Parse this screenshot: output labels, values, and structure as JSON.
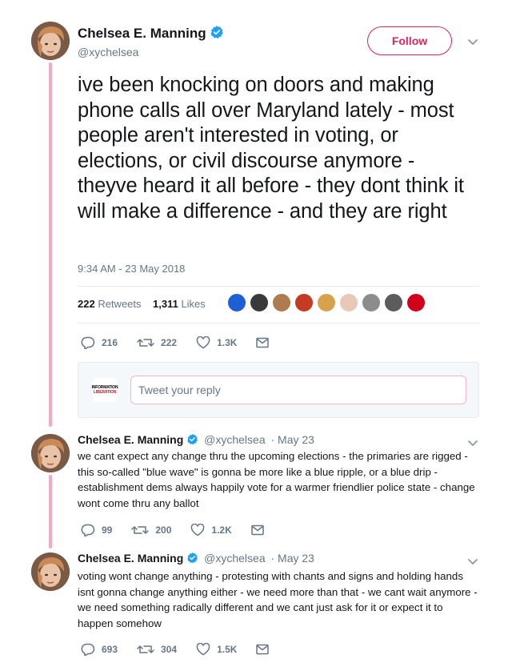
{
  "main_tweet": {
    "author_name": "Chelsea E. Manning",
    "author_handle": "@xychelsea",
    "follow_label": "Follow",
    "text": "ive been knocking on doors and making phone calls all over Maryland lately - most people aren't interested in voting, or elections, or civil discourse anymore - theyve heard it all before - they dont think it will make a difference - and they are right",
    "timestamp": "9:34 AM - 23 May 2018",
    "retweets_count": "222",
    "retweets_label": "Retweets",
    "likes_count": "1,311",
    "likes_label": "Likes",
    "actions": {
      "replies": "216",
      "retweets": "222",
      "likes": "1.3K"
    }
  },
  "likers": [
    {
      "name": "liker-1",
      "color": "#1f5fd6"
    },
    {
      "name": "liker-2",
      "color": "#3a3a3a"
    },
    {
      "name": "liker-3",
      "color": "#b07a4f"
    },
    {
      "name": "liker-4",
      "color": "#c23b22"
    },
    {
      "name": "liker-5",
      "color": "#d8a24c"
    },
    {
      "name": "liker-6",
      "color": "#e7c9b5"
    },
    {
      "name": "liker-7",
      "color": "#8c8c8c"
    },
    {
      "name": "liker-8",
      "color": "#5c5c5c"
    },
    {
      "name": "liker-9",
      "color": "#d0021b"
    }
  ],
  "reply_box": {
    "placeholder": "Tweet your reply",
    "avatar_line1": "INFORMATION",
    "avatar_line2": "LIBERATION"
  },
  "replies": [
    {
      "author_name": "Chelsea E. Manning",
      "author_handle": "@xychelsea",
      "date": "· May 23",
      "text": "we cant expect any change thru the upcoming elections - the primaries are rigged - this so-called \"blue wave\" is gonna be more like a blue ripple, or a blue drip - establishment dems always happily vote for a warmer friendlier police state - change wont come thru any ballot",
      "actions": {
        "replies": "99",
        "retweets": "200",
        "likes": "1.2K"
      }
    },
    {
      "author_name": "Chelsea E. Manning",
      "author_handle": "@xychelsea",
      "date": "· May 23",
      "text": "voting wont change anything - protesting with chants and signs and holding hands isnt gonna change anything either - we need more than that - we cant wait anymore - we need something radically different and we cant just ask for it or expect it to happen somehow",
      "actions": {
        "replies": "693",
        "retweets": "304",
        "likes": "1.5K"
      }
    }
  ],
  "colors": {
    "thread_line": "#f6a9c4",
    "follow_accent": "#e0245e",
    "verified": "#1da1f2",
    "muted": "#657786"
  },
  "icons": [
    "verified-badge-icon",
    "chevron-down-icon",
    "reply-icon",
    "retweet-icon",
    "like-icon",
    "dm-icon"
  ]
}
